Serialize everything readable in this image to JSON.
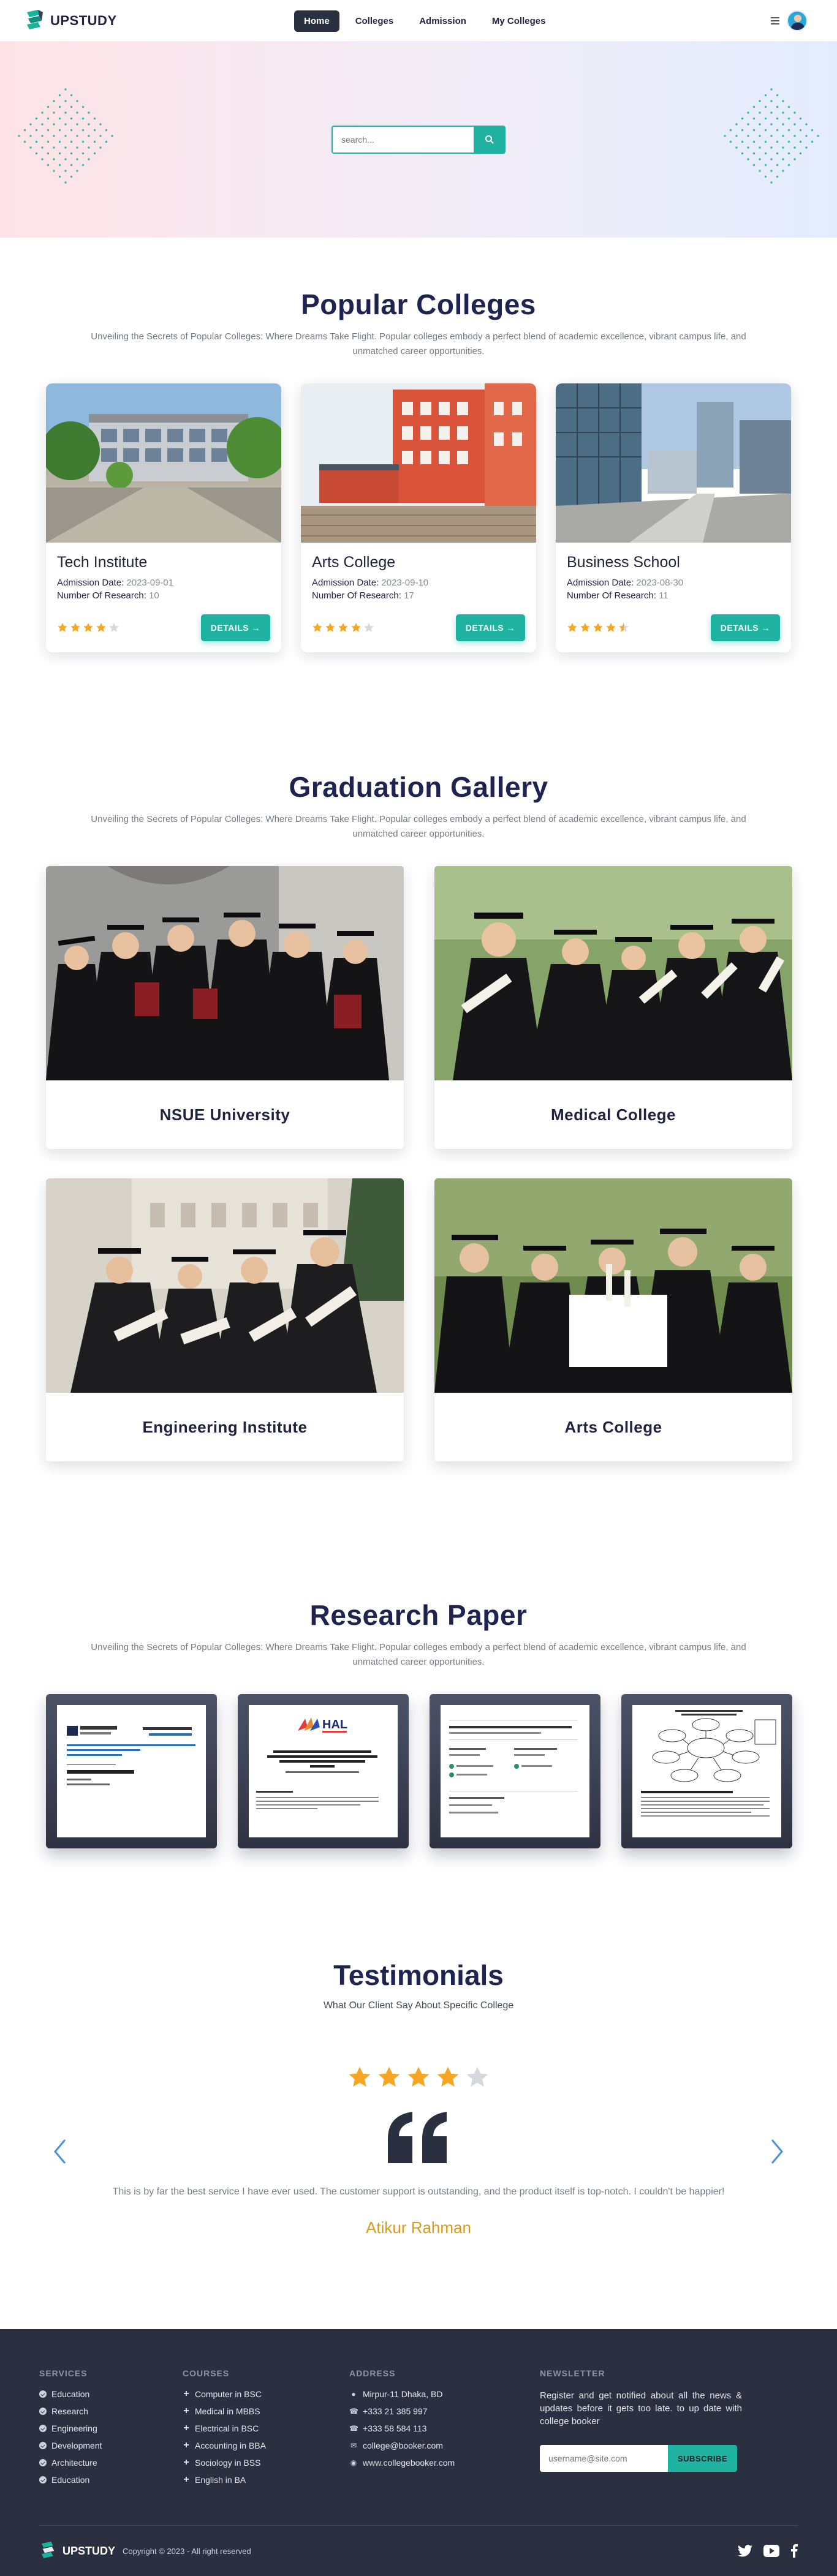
{
  "brand": {
    "name": "UPSTUDY"
  },
  "nav": {
    "links": [
      {
        "label": "Home",
        "active": true
      },
      {
        "label": "Colleges",
        "active": false
      },
      {
        "label": "Admission",
        "active": false
      },
      {
        "label": "My Colleges",
        "active": false
      }
    ],
    "menu_icon": "hamburger-icon",
    "avatar": "user-avatar"
  },
  "hero": {
    "search_placeholder": "search...",
    "search_icon": "search-icon"
  },
  "colleges": {
    "title": "Popular Colleges",
    "subtitle": "Unveiling the Secrets of Popular Colleges: Where Dreams Take Flight. Popular colleges embody a perfect blend of academic excellence, vibrant campus life, and unmatched career opportunities.",
    "admission_label": "Admission Date:",
    "research_label": "Number Of Research:",
    "details_label": "DETAILS →",
    "items": [
      {
        "name": "Tech Institute",
        "admission_date": "2023-09-01",
        "research_count": "10",
        "rating": 4
      },
      {
        "name": "Arts College",
        "admission_date": "2023-09-10",
        "research_count": "17",
        "rating": 4
      },
      {
        "name": "Business School",
        "admission_date": "2023-08-30",
        "research_count": "11",
        "rating": 4.5
      }
    ]
  },
  "gallery": {
    "title": "Graduation Gallery",
    "subtitle": "Unveiling the Secrets of Popular Colleges: Where Dreams Take Flight. Popular colleges embody a perfect blend of academic excellence, vibrant campus life, and unmatched career opportunities.",
    "items": [
      {
        "caption": "NSUE University"
      },
      {
        "caption": "Medical College"
      },
      {
        "caption": "Engineering Institute"
      },
      {
        "caption": "Arts College"
      }
    ]
  },
  "research": {
    "title": "Research Paper",
    "subtitle": "Unveiling the Secrets of Popular Colleges: Where Dreams Take Flight. Popular colleges embody a perfect blend of academic excellence, vibrant campus life, and unmatched career opportunities.",
    "papers": [
      {
        "heading": "Open Source Research in Sustainability",
        "org": "Michigan Technological University"
      },
      {
        "heading": "Overcoming Language Challenges of Open Source",
        "org": "HAL"
      },
      {
        "heading": "Technologies for Comprehensive Image Understanding",
        "org": ""
      },
      {
        "heading": "Data Sustainability Practices",
        "org": ""
      }
    ]
  },
  "testimonials": {
    "title": "Testimonials",
    "subtitle": "What Our Client Say About Specific College",
    "rating": 4,
    "text": "This is by far the best service I have ever used. The customer support is outstanding, and the product itself is top-notch. I couldn't be happier!",
    "author": "Atikur Rahman"
  },
  "footer": {
    "services": {
      "heading": "SERVICES",
      "items": [
        "Education",
        "Research",
        "Engineering",
        "Development",
        "Architecture",
        "Education"
      ]
    },
    "courses": {
      "heading": "COURSES",
      "items": [
        "Computer in BSC",
        "Medical in MBBS",
        "Electrical in BSC",
        "Accounting in BBA",
        "Sociology in BSS",
        "English in BA"
      ]
    },
    "address": {
      "heading": "ADDRESS",
      "items": [
        {
          "icon": "location-icon",
          "text": "Mirpur-11 Dhaka, BD"
        },
        {
          "icon": "phone-icon",
          "text": "+333 21 385 997"
        },
        {
          "icon": "phone-icon",
          "text": "+333 58 584 113"
        },
        {
          "icon": "email-icon",
          "text": "college@booker.com"
        },
        {
          "icon": "globe-icon",
          "text": "www.collegebooker.com"
        }
      ]
    },
    "newsletter": {
      "heading": "NEWSLETTER",
      "text": "Register and get notified about all the news & updates before it gets too late. to up date with college booker",
      "placeholder": "username@site.com",
      "button": "SUBSCRIBE"
    },
    "copyright": "Copyright © 2023 - All right reserved",
    "socials": [
      "twitter-icon",
      "youtube-icon",
      "facebook-icon"
    ]
  },
  "colors": {
    "primary": "#20b2a0",
    "dark": "#2b3040",
    "heading": "#1f2350",
    "star": "#f5a623",
    "author": "#d99a1a"
  }
}
